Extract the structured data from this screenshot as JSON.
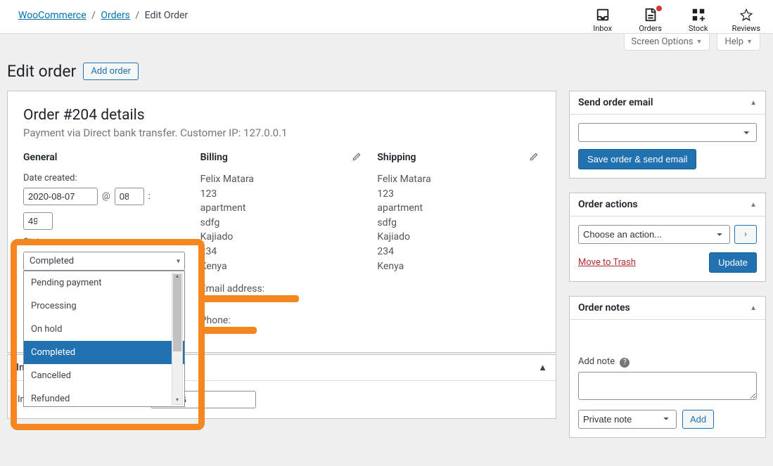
{
  "breadcrumb": {
    "root": "WooCommerce",
    "orders": "Orders",
    "current": "Edit Order"
  },
  "activity": {
    "inbox": "Inbox",
    "orders": "Orders",
    "stock": "Stock",
    "reviews": "Reviews"
  },
  "screen": {
    "options": "Screen Options",
    "help": "Help"
  },
  "heading": {
    "title": "Edit order",
    "add": "Add order"
  },
  "order": {
    "title": "Order #204 details",
    "subtitle": "Payment via Direct bank transfer. Customer IP: 127.0.0.1",
    "general": {
      "heading": "General",
      "date_label": "Date created:",
      "date": "2020-08-07",
      "at": "@",
      "hour": "08",
      "minute": "49",
      "colon": ":",
      "status_label": "Status:",
      "status_value": "Completed",
      "options": {
        "0": "Pending payment",
        "1": "Processing",
        "2": "On hold",
        "3": "Completed",
        "4": "Cancelled",
        "5": "Refunded"
      }
    },
    "billing": {
      "heading": "Billing",
      "lines": {
        "0": "Felix Matara",
        "1": "123",
        "2": "apartment",
        "3": "sdfg",
        "4": "Kajiado",
        "5": "234",
        "6": "Kenya"
      },
      "email_label": "Email address:",
      "phone_label": "Phone:"
    },
    "shipping": {
      "heading": "Shipping",
      "lines": {
        "0": "Felix Matara",
        "1": "123",
        "2": "apartment",
        "3": "sdfg",
        "4": "Kajiado",
        "5": "234",
        "6": "Kenya"
      }
    }
  },
  "invoice": {
    "heading": "Invoice",
    "number_label": "Invoice Number (unformatted!):",
    "number": "123456"
  },
  "side_email": {
    "heading": "Send order email",
    "button": "Save order & send email"
  },
  "side_actions": {
    "heading": "Order actions",
    "placeholder": "Choose an action...",
    "trash": "Move to Trash",
    "update": "Update"
  },
  "side_notes": {
    "heading": "Order notes",
    "add_label": "Add note",
    "type": "Private note",
    "add_btn": "Add"
  }
}
